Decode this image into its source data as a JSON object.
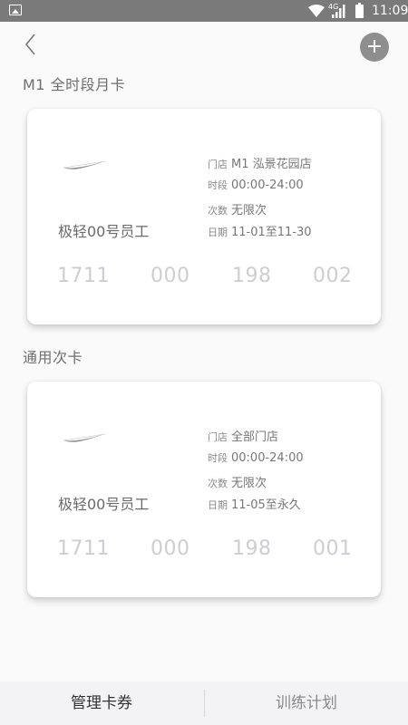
{
  "status_bar": {
    "time": "11:09",
    "network": "4G",
    "icons": [
      "image-icon",
      "wifi-icon",
      "signal-icon",
      "battery-icon"
    ]
  },
  "header": {
    "back_icon": "chevron-left-icon",
    "add_icon": "plus-icon",
    "add_label": "+"
  },
  "cards": [
    {
      "section_title": "M1 全时段月卡",
      "holder": "极轻00号员工",
      "store_label": "门店",
      "store_value": "M1 泓景花园店",
      "period_label": "时段",
      "period_value": "00:00-24:00",
      "count_label": "次数",
      "count_value": "无限次",
      "date_label": "日期",
      "date_value": "11-01至11-30",
      "number": [
        "1711",
        "000",
        "198",
        "002"
      ]
    },
    {
      "section_title": "通用次卡",
      "holder": "极轻00号员工",
      "store_label": "门店",
      "store_value": "全部门店",
      "period_label": "时段",
      "period_value": "00:00-24:00",
      "count_label": "次数",
      "count_value": "无限次",
      "date_label": "日期",
      "date_value": "11-05至永久",
      "number": [
        "1711",
        "000",
        "198",
        "001"
      ]
    }
  ],
  "tabs": [
    {
      "label": "管理卡券",
      "active": true
    },
    {
      "label": "训练计划",
      "active": false
    }
  ],
  "colors": {
    "status_bar": "#7a7a7a",
    "add_button": "#8e8e8e",
    "card_number": "#cdcdd3",
    "tab_bar": "#f3f2f4"
  }
}
